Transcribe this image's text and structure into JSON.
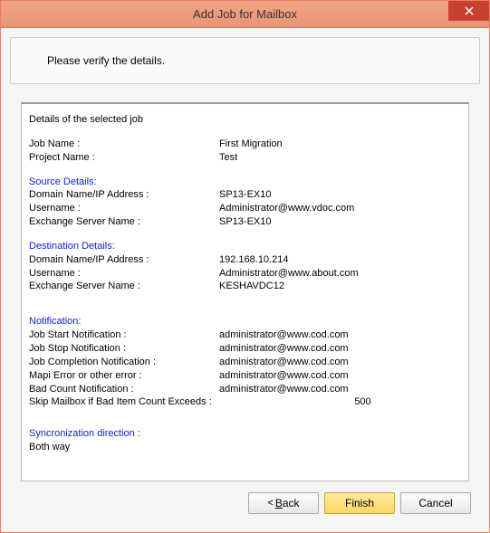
{
  "window": {
    "title": "Add Job for Mailbox"
  },
  "instruction": "Please verify the details.",
  "details": {
    "heading": "Details of the selected job",
    "job": {
      "jobNameLabel": "Job Name :",
      "jobNameValue": "First Migration",
      "projectNameLabel": "Project Name :",
      "projectNameValue": "Test"
    },
    "source": {
      "heading": "Source Details:",
      "domainLabel": "Domain Name/IP Address :",
      "domainValue": "SP13-EX10",
      "usernameLabel": "Username :",
      "usernameValue": "Administrator@www.vdoc.com",
      "exchangeLabel": "Exchange Server Name :",
      "exchangeValue": "SP13-EX10"
    },
    "destination": {
      "heading": "Destination Details:",
      "domainLabel": "Domain Name/IP Address :",
      "domainValue": "192.168.10.214",
      "usernameLabel": "Username :",
      "usernameValue": "Administrator@www.about.com",
      "exchangeLabel": "Exchange Server Name :",
      "exchangeValue": "KESHAVDC12"
    },
    "notification": {
      "heading": "Notification:",
      "startLabel": "Job Start Notification :",
      "startValue": "administrator@www.cod.com",
      "stopLabel": "Job Stop Notification :",
      "stopValue": "administrator@www.cod.com",
      "completionLabel": "Job Completion Notification :",
      "completionValue": "administrator@www.cod.com",
      "mapiLabel": "Mapi Error or other error :",
      "mapiValue": "administrator@www.cod.com",
      "badCountLabel": "Bad Count Notification :",
      "badCountValue": "administrator@www.cod.com",
      "skipLabel": "Skip Mailbox if Bad Item Count Exceeds  :",
      "skipValue": "500"
    },
    "sync": {
      "heading": "Syncronization direction :",
      "value": "Both way"
    }
  },
  "buttons": {
    "back": "Back",
    "backArrow": "<",
    "finish": "Finish",
    "cancel": "Cancel"
  }
}
